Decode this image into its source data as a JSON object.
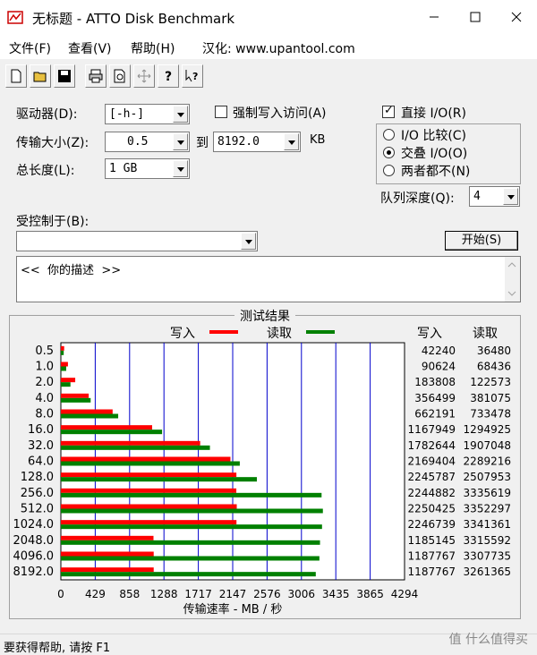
{
  "window": {
    "title": "无标题 - ATTO Disk Benchmark"
  },
  "menu": {
    "file": "文件(F)",
    "view": "查看(V)",
    "help": "帮助(H)",
    "site": "汉化: www.upantool.com"
  },
  "form": {
    "drive_label": "驱动器(D):",
    "drive_value": "[-h-]",
    "transfer_label": "传输大小(Z):",
    "transfer_from": "0.5",
    "transfer_to_label": "到",
    "transfer_to": "8192.0",
    "transfer_unit": "KB",
    "length_label": "总长度(L):",
    "length_value": "1 GB",
    "force_write_label": "强制写入访问(A)",
    "direct_io_label": "直接 I/O(R)",
    "io_compare_label": "I/O 比较(C)",
    "overlap_io_label": "交叠 I/O(O)",
    "neither_label": "两者都不(N)",
    "queue_depth_label": "队列深度(Q):",
    "queue_depth_value": "4",
    "controlled_by_label": "受控制于(B):",
    "controlled_by_value": "",
    "start_button": "开始(S)",
    "description": "<<  你的描述  >>"
  },
  "status": {
    "text": "要获得帮助, 请按 F1"
  },
  "watermark": "值 什么值得买",
  "chart_data": {
    "type": "bar",
    "title": "测试结果",
    "legend": [
      "写入",
      "读取"
    ],
    "xlabel": "传输速率 - MB / 秒",
    "col_write": "写入",
    "col_read": "读取",
    "xlim": [
      0,
      4294
    ],
    "xticks": [
      "0",
      "429",
      "858",
      "1288",
      "1717",
      "2147",
      "2576",
      "3006",
      "3435",
      "3865",
      "4294"
    ],
    "categories": [
      "0.5",
      "1.0",
      "2.0",
      "4.0",
      "8.0",
      "16.0",
      "32.0",
      "64.0",
      "128.0",
      "256.0",
      "512.0",
      "1024.0",
      "2048.0",
      "4096.0",
      "8192.0"
    ],
    "series": [
      {
        "name": "写入",
        "color": "#ff0000",
        "values": [
          42240,
          90624,
          183808,
          356499,
          662191,
          1167949,
          1782644,
          2169404,
          2245787,
          2244882,
          2250425,
          2246739,
          1185145,
          1187767,
          1187767
        ]
      },
      {
        "name": "读取",
        "color": "#008000",
        "values": [
          36480,
          68436,
          122573,
          381075,
          733478,
          1294925,
          1907048,
          2289216,
          2507953,
          3335619,
          3352297,
          3341361,
          3315592,
          3307735,
          3261365
        ]
      }
    ]
  }
}
